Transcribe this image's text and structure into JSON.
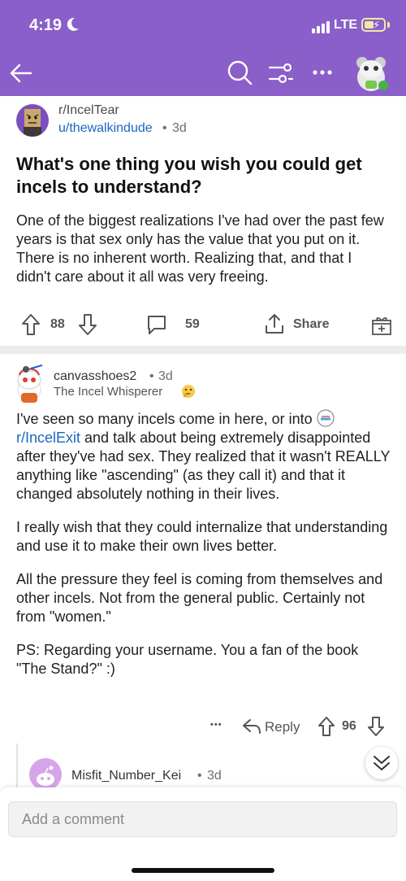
{
  "status_bar": {
    "time": "4:19",
    "network": "LTE"
  },
  "post": {
    "subreddit": "r/IncelTear",
    "author": "u/thewalkindude",
    "separator": "•",
    "age": "3d",
    "title": "What's one thing you wish you could get incels to understand?",
    "body": "One of the biggest realizations I've had over the past few years is that sex only has the value that you put on it.  There is no inherent worth. Realizing that, and that I didn't care about it all was very freeing.",
    "upvotes": "88",
    "comments": "59",
    "share_label": "Share"
  },
  "comment": {
    "author": "canvasshoes2",
    "separator": "•",
    "age": "3d",
    "flair": "The Incel Whisperer",
    "para1_before": "I've seen so many incels come in here, or into ",
    "para1_link": "r/IncelExit",
    "para1_after": " and talk about being extremely disappointed after they've had sex.  They realized that it wasn't REALLY anything like \"ascending\" (as they call it) and that it changed absolutely nothing in their lives.",
    "para2": "I really wish that they could internalize that understanding and use it to make their own lives better.",
    "para3": "All the pressure they feel is coming from themselves and other incels.  Not from the general public. Certainly not from \"women.\"",
    "para4": "PS: Regarding your username.  You a fan of the book \"The Stand?\"  :)",
    "more": "•••",
    "reply_label": "Reply",
    "votes": "96"
  },
  "reply_preview": {
    "author": "Misfit_Number_Kei",
    "separator": "•",
    "age": "3d"
  },
  "composer": {
    "placeholder": "Add a comment"
  },
  "colors": {
    "header": "#8a5fc9",
    "link": "#1a66c0",
    "divider": "#ececec"
  }
}
